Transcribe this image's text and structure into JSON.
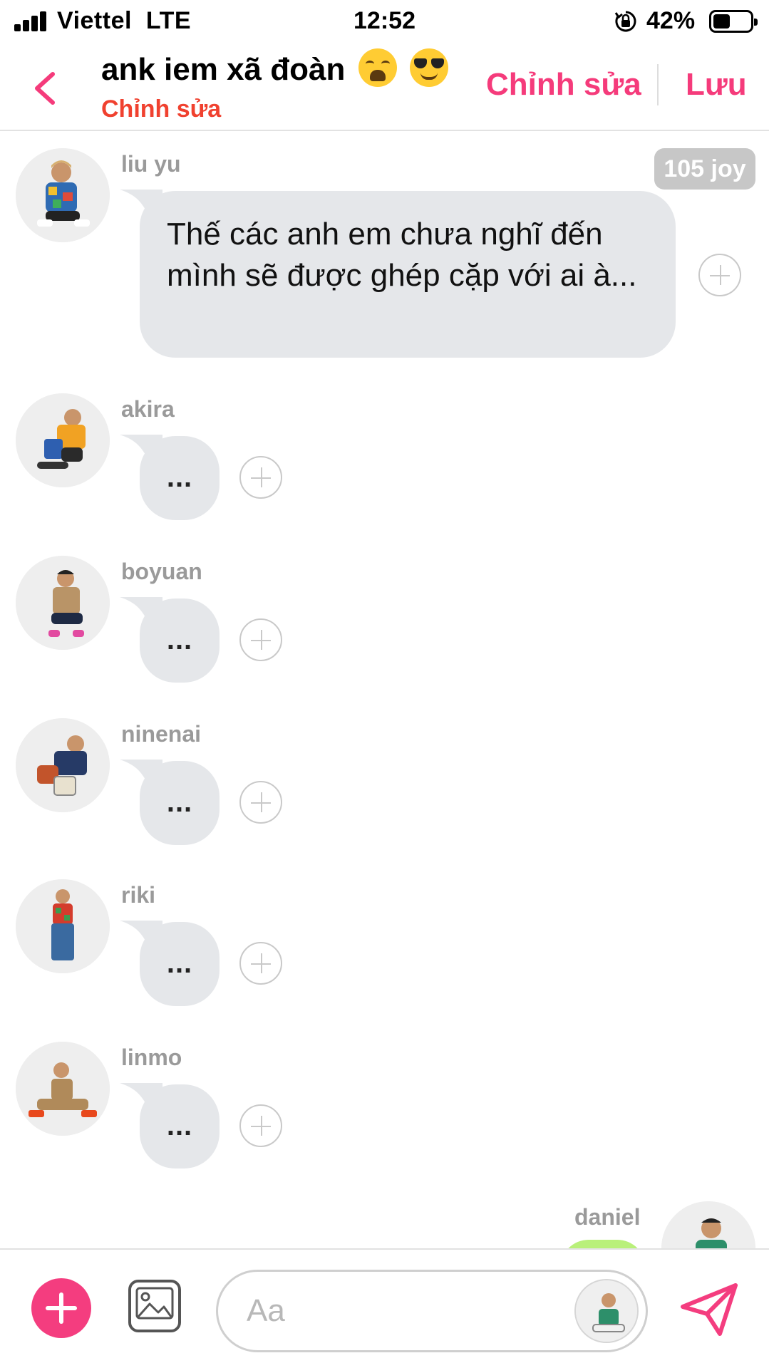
{
  "status_bar": {
    "carrier": "Viettel",
    "network": "LTE",
    "time": "12:52",
    "battery": "42%",
    "battery_level": 0.42
  },
  "header": {
    "title": "ank iem xã đoàn",
    "title_emojis": [
      "weary-face",
      "smiling-face-with-sunglasses"
    ],
    "subtitle": "Chỉnh sửa",
    "edit_label": "Chỉnh sửa",
    "save_label": "Lưu"
  },
  "messages": [
    {
      "sender": "liu yu",
      "text": "Thế các anh em chưa nghĩ đến mình sẽ được ghép cặp với ai à...",
      "badge": "105 joy"
    },
    {
      "sender": "akira",
      "text": "..."
    },
    {
      "sender": "boyuan",
      "text": "..."
    },
    {
      "sender": "ninenai",
      "text": "..."
    },
    {
      "sender": "riki",
      "text": "..."
    },
    {
      "sender": "linmo",
      "text": "..."
    },
    {
      "sender": "daniel",
      "text": ""
    }
  ],
  "composer": {
    "placeholder": "Aa"
  },
  "colors": {
    "accent": "#f53b7b",
    "subtitle": "#f0412f",
    "bubble": "#e5e7ea",
    "own_bubble": "#b9f07a"
  }
}
